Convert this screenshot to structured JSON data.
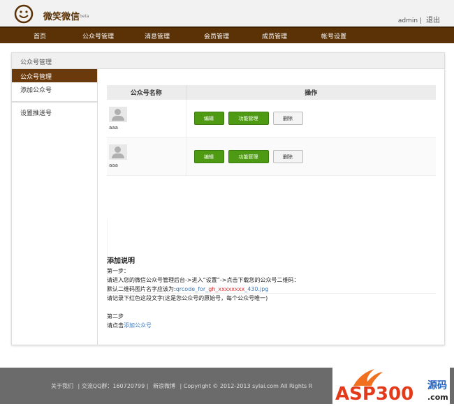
{
  "header": {
    "brand": "微笑微信",
    "beta": "beta",
    "user": "admin",
    "sep": "|",
    "logout": "退出"
  },
  "nav": [
    "首页",
    "公众号管理",
    "消息管理",
    "会员管理",
    "成员管理",
    "帐号设置"
  ],
  "panel": {
    "title": "公众号管理"
  },
  "sidebar": [
    "公众号管理",
    "添加公众号",
    "设置推送号"
  ],
  "table": {
    "headers": [
      "公众号名称",
      "操作"
    ],
    "rows": [
      {
        "name": "aaa"
      },
      {
        "name": "aaa"
      }
    ],
    "buttons": {
      "edit": "编辑",
      "func": "功能管理",
      "delete": "删除"
    }
  },
  "notes": {
    "title": "添加说明",
    "step1": "第一步：",
    "line1": "请进入您的微信公众号管理后台->进入“设置”->点击下载您的公众号二维码：",
    "line2_pre": "默认二维码图片名字应该为:",
    "line2_a": "qrcode_for_",
    "line2_red": "gh_xxxxxxxx",
    "line2_b": "_430.jpg",
    "line3": "请记录下红色这段文字(这是您公众号的原始号，每个公众号唯一)",
    "step2": "第二步",
    "line4_pre": "请点击",
    "line4_link": "添加公众号"
  },
  "footer": {
    "about": "关于我们",
    "qq": "| 交流QQ群：160720799 |",
    "weibo": "新浪微博",
    "copyright": "| Copyright © 2012-2013 sylai.com All Rights R"
  },
  "watermark": "ASP300 源码 .com"
}
